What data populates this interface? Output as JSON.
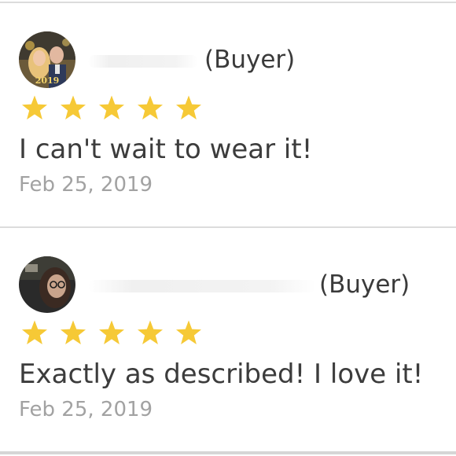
{
  "reviews": [
    {
      "buyer_label": "(Buyer)",
      "rating": 5,
      "text": "I can't wait to wear it!",
      "date": "Feb 25, 2019",
      "avatar_caption": "2019"
    },
    {
      "buyer_label": "(Buyer)",
      "rating": 5,
      "text": "Exactly as described! I love it!",
      "date": "Feb 25, 2019"
    }
  ],
  "colors": {
    "star": "#f6c936",
    "text": "#3c3c3c",
    "date": "#a2a2a2",
    "divider": "#dcdcdc"
  },
  "icons": {
    "star": "star-icon"
  }
}
